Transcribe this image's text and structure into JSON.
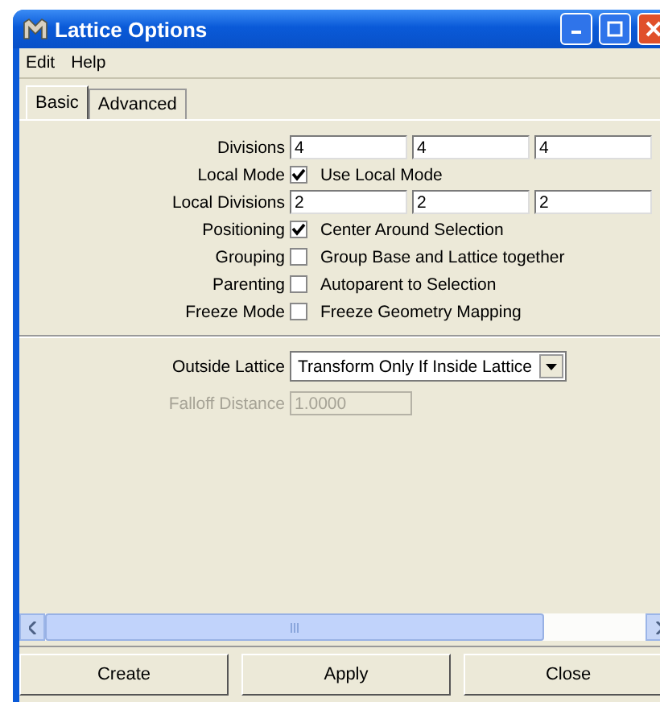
{
  "window": {
    "title": "Lattice Options"
  },
  "menu": [
    "Edit",
    "Help"
  ],
  "tabs": [
    {
      "label": "Basic",
      "selected": true
    },
    {
      "label": "Advanced",
      "selected": false
    }
  ],
  "rows": [
    {
      "kind": "fields",
      "label": "Divisions",
      "values": [
        "4",
        "4",
        "4"
      ]
    },
    {
      "kind": "checkbox",
      "label": "Local Mode",
      "text": "Use Local Mode",
      "checked": true
    },
    {
      "kind": "fields",
      "label": "Local Divisions",
      "values": [
        "2",
        "2",
        "2"
      ]
    },
    {
      "kind": "checkbox",
      "label": "Positioning",
      "text": "Center Around Selection",
      "checked": true
    },
    {
      "kind": "checkbox",
      "label": "Grouping",
      "text": "Group Base and Lattice together",
      "checked": false
    },
    {
      "kind": "checkbox",
      "label": "Parenting",
      "text": "Autoparent to Selection",
      "checked": false
    },
    {
      "kind": "checkbox",
      "label": "Freeze Mode",
      "text": "Freeze Geometry Mapping",
      "checked": false
    }
  ],
  "outside_lattice": {
    "label": "Outside Lattice",
    "value": "Transform Only If Inside Lattice"
  },
  "falloff_distance": {
    "label": "Falloff Distance",
    "value": "1.0000",
    "disabled": true
  },
  "buttons": [
    "Create",
    "Apply",
    "Close"
  ]
}
